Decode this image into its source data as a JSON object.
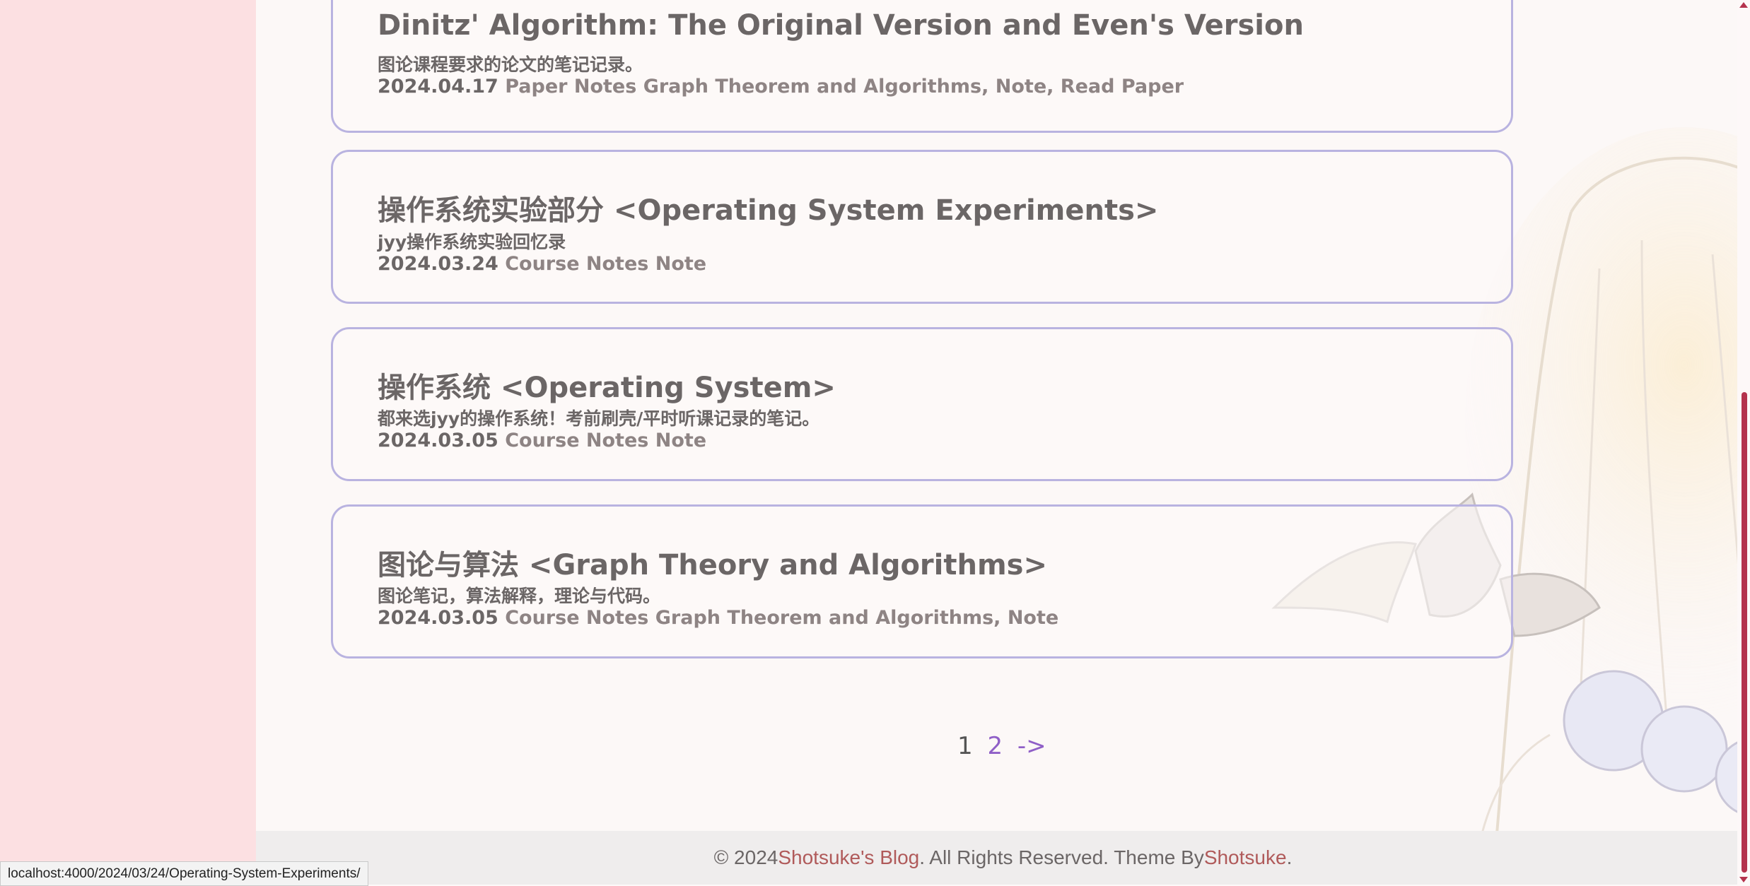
{
  "posts": [
    {
      "title": "Dinitz' Algorithm: The Original Version and Even's Version",
      "description": "图论课程要求的论文的笔记记录。",
      "date": "2024.04.17",
      "categories": "Paper Notes",
      "tags": "Graph Theorem and Algorithms, Note, Read Paper"
    },
    {
      "title": "操作系统实验部分 <Operating System Experiments>",
      "description": "jyy操作系统实验回忆录",
      "date": "2024.03.24",
      "categories": "Course Notes",
      "tags": "Note"
    },
    {
      "title": "操作系统 <Operating System>",
      "description": "都来选jyy的操作系统！考前刷壳/平时听课记录的笔记。",
      "date": "2024.03.05",
      "categories": "Course Notes",
      "tags": "Note"
    },
    {
      "title": "图论与算法 <Graph Theory and Algorithms>",
      "description": "图论笔记，算法解释，理论与代码。",
      "date": "2024.03.05",
      "categories": "Course Notes",
      "tags": "Graph Theorem and Algorithms, Note"
    }
  ],
  "pagination": {
    "current": "1",
    "next_page": "2",
    "next_arrow": "->"
  },
  "footer": {
    "prefix": "© 2024",
    "blog_name": "Shotsuke's Blog",
    "middle": ". All Rights Reserved. Theme By",
    "theme_author": "Shotsuke",
    "suffix": "."
  },
  "status_bar": {
    "url": "localhost:4000/2024/03/24/Operating-System-Experiments/"
  },
  "colors": {
    "card_border": "#b9b3e0",
    "sidebar_bg": "#fce0e2",
    "link": "#8f5fc7",
    "footer_link": "#b05a5a",
    "scroll_thumb": "#b4324d"
  }
}
